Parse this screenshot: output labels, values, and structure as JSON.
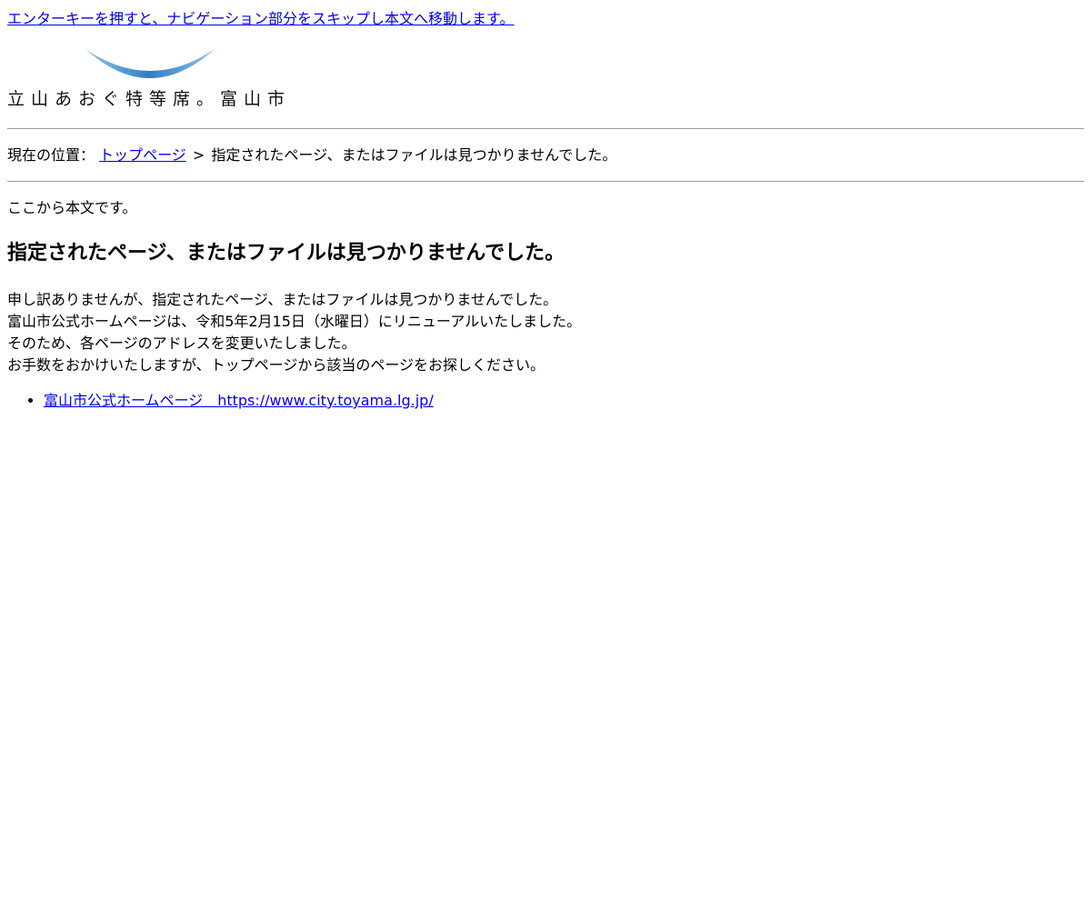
{
  "skip_link": {
    "label": "エンターキーを押すと、ナビゲーション部分をスキップし本文へ移動します。"
  },
  "logo": {
    "text": "立山あおぐ特等席。富山市",
    "arc_color_light": "#8ec3ea",
    "arc_color_dark": "#2f7fc4"
  },
  "breadcrumb": {
    "prefix": "現在の位置：",
    "home_label": "トップページ",
    "separator": ">",
    "current": "指定されたページ、またはファイルは見つかりませんでした。"
  },
  "main": {
    "content_start": "ここから本文です。",
    "title": "指定されたページ、またはファイルは見つかりませんでした。",
    "paragraphs": [
      "申し訳ありませんが、指定されたページ、またはファイルは見つかりませんでした。",
      "富山市公式ホームページは、令和5年2月15日（水曜日）にリニューアルいたしました。",
      "そのため、各ページのアドレスを変更いたしました。",
      "お手数をおかけいたしますが、トップページから該当のページをお探しください。"
    ],
    "links": [
      {
        "label": "富山市公式ホームページ　https://www.city.toyama.lg.jp/"
      }
    ]
  },
  "colors": {
    "link": "#0000ee",
    "rule": "#9a9a9a"
  }
}
